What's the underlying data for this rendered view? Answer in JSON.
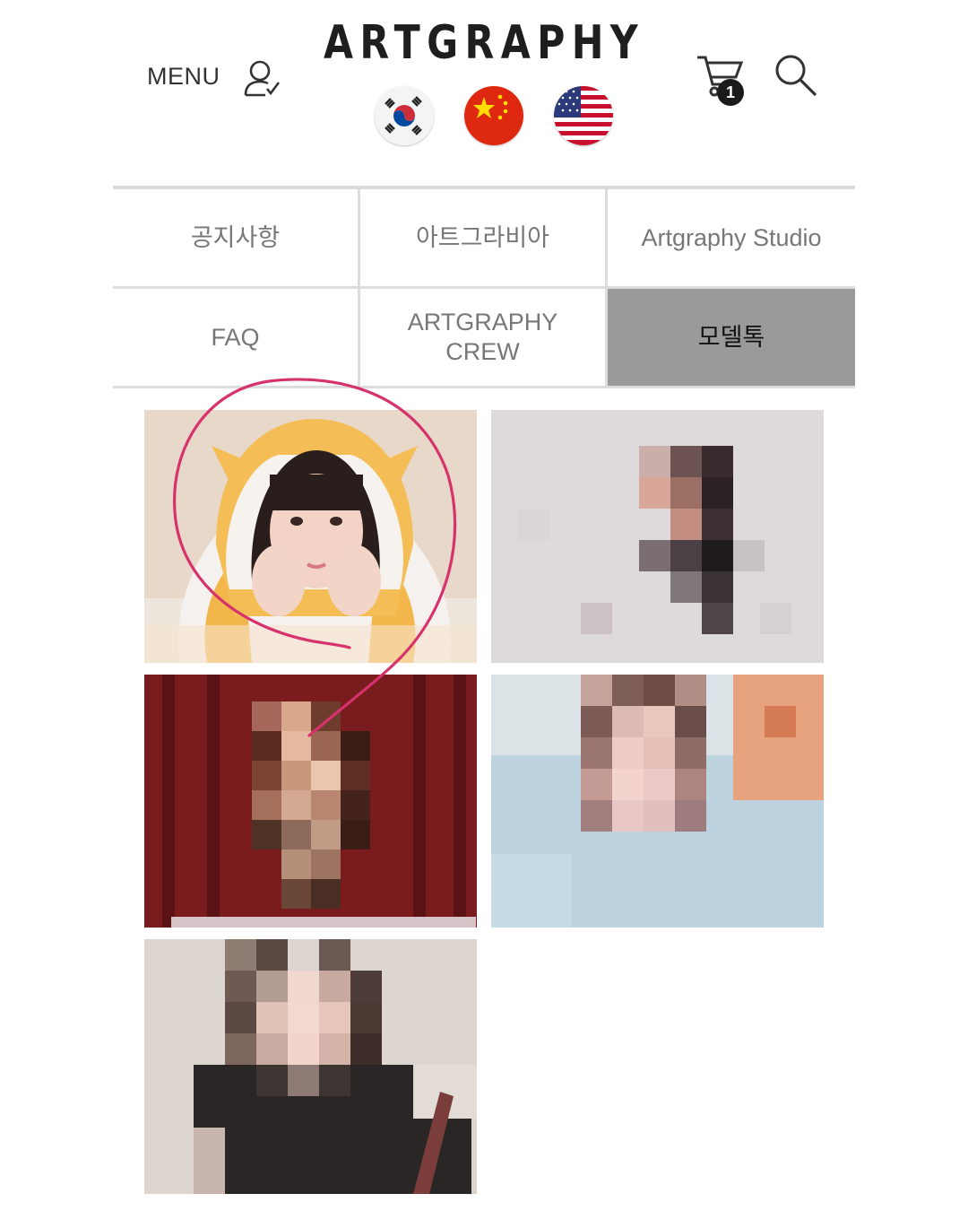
{
  "header": {
    "menu_label": "MENU",
    "logo_text": "ARTGRAPHY",
    "cart_count": "1",
    "flags": [
      "korea-flag-icon",
      "china-flag-icon",
      "usa-flag-icon"
    ]
  },
  "nav": {
    "items": [
      {
        "label": "공지사항"
      },
      {
        "label": "아트그라비아"
      },
      {
        "label": "Artgraphy Studio"
      },
      {
        "label": "FAQ"
      },
      {
        "label": "ARTGRAPHY CREW"
      },
      {
        "label": "모델톡",
        "active": true
      }
    ]
  },
  "colors": {
    "annotation": "#d6336c",
    "active_tab": "#9a9a9a",
    "logo": "#1e1e1e"
  },
  "gallery": {
    "thumbnails": [
      "model-photo-1",
      "model-photo-2-pixelated",
      "model-photo-3-pixelated",
      "model-photo-4-pixelated",
      "model-photo-5-pixelated"
    ]
  }
}
